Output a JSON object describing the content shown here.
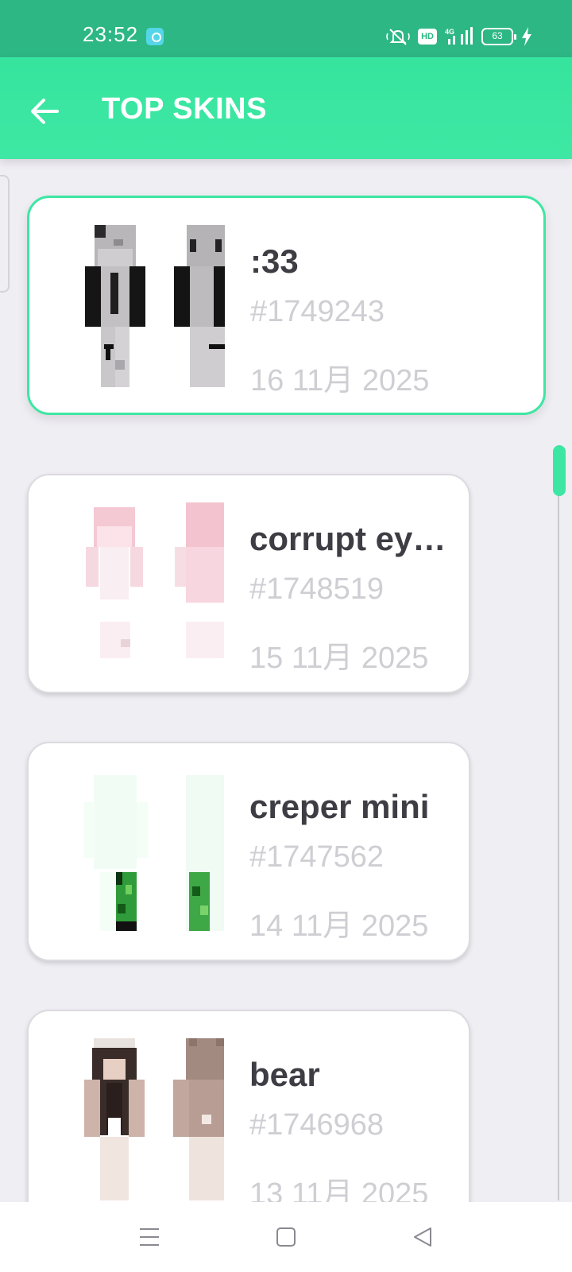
{
  "status_bar": {
    "time": "23:52",
    "app_icon": "chat-bubble-icon",
    "hd_label": "HD",
    "network_label": "4G",
    "battery_level": "63",
    "icons": [
      "mute-icon",
      "signal-icon",
      "battery-icon",
      "charging-bolt-icon"
    ]
  },
  "app_bar": {
    "back_icon": "arrow-left-icon",
    "title": "TOP SKINS"
  },
  "colors": {
    "status_bar": "#2db785",
    "app_bar": "#3ee8a4",
    "accent": "#3ee6a3",
    "background": "#efeef3",
    "card": "#ffffff",
    "title_text": "#3e3d44",
    "meta_text": "#cfced3"
  },
  "skins": [
    {
      "name": ":33",
      "id": "#1749243",
      "date": "16 11月 2025",
      "selected": true,
      "preview": "gray-girl-skin"
    },
    {
      "name": "corrupt eye…",
      "id": "#1748519",
      "date": "15 11月 2025",
      "selected": false,
      "preview": "pink-girl-skin"
    },
    {
      "name": "creper mini",
      "id": "#1747562",
      "date": "14 11月 2025",
      "selected": false,
      "preview": "creeper-skin"
    },
    {
      "name": "bear",
      "id": "#1746968",
      "date": "13 11月 2025",
      "selected": false,
      "preview": "bear-hoodie-skin"
    }
  ],
  "nav_bar": {
    "icons": [
      "menu-icon",
      "home-icon",
      "back-triangle-icon"
    ]
  }
}
